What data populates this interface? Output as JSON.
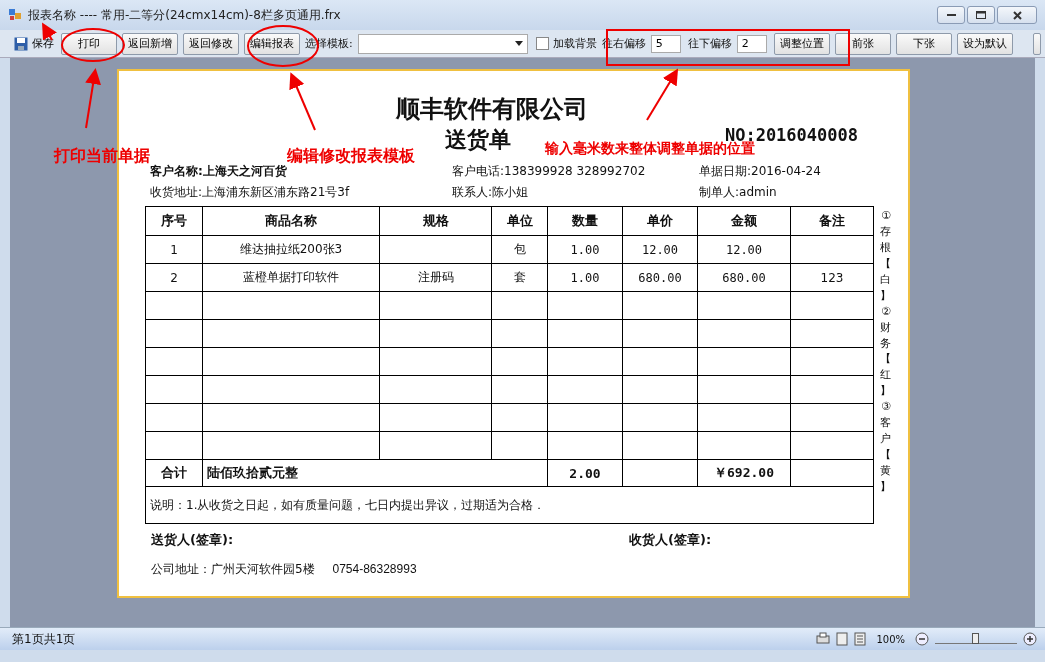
{
  "window": {
    "title": "报表名称 ---- 常用-二等分(24cmx14cm)-8栏多页通用.frx"
  },
  "toolbar": [
    {
      "kind": "save",
      "label": "保存"
    },
    {
      "kind": "button",
      "label": "打印"
    },
    {
      "kind": "button",
      "label": "返回新增"
    },
    {
      "kind": "button",
      "label": "返回修改"
    },
    {
      "kind": "button",
      "label": "编辑报表"
    },
    {
      "kind": "label",
      "label": "选择模板:"
    },
    {
      "kind": "select"
    },
    {
      "kind": "checkbox",
      "label": "加载背景",
      "checked": false
    },
    {
      "kind": "label",
      "label": "往右偏移"
    },
    {
      "kind": "input",
      "value": "5"
    },
    {
      "kind": "label",
      "label": "往下偏移"
    },
    {
      "kind": "input",
      "value": "2"
    },
    {
      "kind": "button",
      "label": "调整位置"
    },
    {
      "kind": "button",
      "label": "前张"
    },
    {
      "kind": "button",
      "label": "下张"
    },
    {
      "kind": "button",
      "label": "设为默认"
    }
  ],
  "document": {
    "company": "顺丰软件有限公司",
    "title": "送货单",
    "number": "NO:2016040008",
    "info": [
      [
        "**客户名称:上海天之河百货**",
        "客户电话:138399928 328992702",
        "单据日期:2016-04-24"
      ],
      [
        "收货地址:上海浦东新区浦东路21号3f",
        "联系人:陈小姐",
        "制单人:admin"
      ]
    ],
    "table": {
      "columns": [
        "序号",
        "商品名称",
        "规格",
        "单位",
        "数量",
        "单价",
        "金额",
        "备注"
      ],
      "rows": [
        [
          "1",
          "维达抽拉纸200张3",
          "",
          "包",
          "1.00",
          "12.00",
          "12.00",
          ""
        ],
        [
          "2",
          "蓝橙单据打印软件",
          "注册码",
          "套",
          "1.00",
          "680.00",
          "680.00",
          "123"
        ],
        [
          "",
          "",
          "",
          "",
          "",
          "",
          "",
          ""
        ],
        [
          "",
          "",
          "",
          "",
          "",
          "",
          "",
          ""
        ],
        [
          "",
          "",
          "",
          "",
          "",
          "",
          "",
          ""
        ],
        [
          "",
          "",
          "",
          "",
          "",
          "",
          "",
          ""
        ],
        [
          "",
          "",
          "",
          "",
          "",
          "",
          "",
          ""
        ],
        [
          "",
          "",
          "",
          "",
          "",
          "",
          "",
          ""
        ]
      ],
      "total": {
        "label": "合计",
        "amount_words": "陆佰玖拾贰元整",
        "quantity": "2.00",
        "amount": "￥692.00"
      },
      "note": "说明：1.从收货之日起，如有质量问题，七日内提出异议，过期适为合格．"
    },
    "side_text": "①存根【白】②财务【红】③客户【黄】",
    "signatures": [
      "送货人(签章):",
      "收货人(签章):"
    ],
    "footer": "公司地址：广州天河软件园5楼",
    "phone": "0754-86328993"
  },
  "status_bar": {
    "page": "第1页共1页",
    "zoom": "100%",
    "zoom_slider": {
      "level": 0.5
    }
  },
  "annotations": [
    "打印当前单据",
    "编辑修改报表模板",
    "输入毫米数来整体调整单据的位置"
  ]
}
